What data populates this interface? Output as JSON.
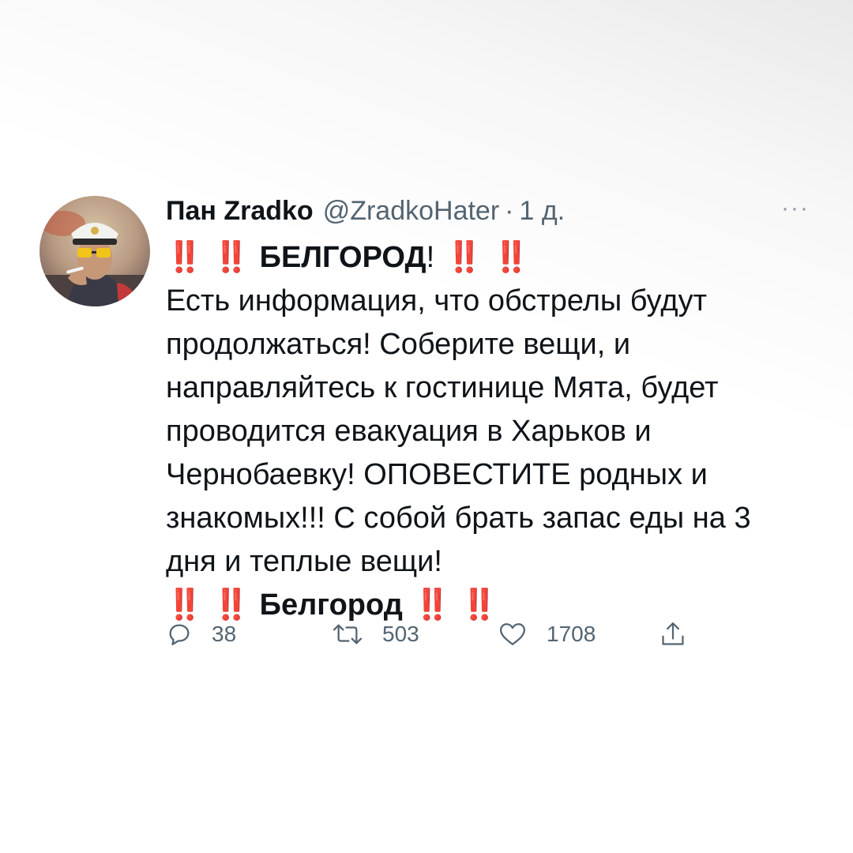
{
  "tweet": {
    "display_name": "Пан Zradko",
    "handle": "@ZradkoHater",
    "separator": "·",
    "time": "1 д.",
    "more": "···",
    "headline": {
      "marks_before": [
        "‼️",
        "‼️"
      ],
      "text": "БЕЛГОРОД",
      "bang": "!",
      "marks_after": [
        "‼️",
        "‼️"
      ]
    },
    "body": "Есть информация, что обстрелы будут продолжаться! Соберите вещи, и направляйтесь к гостинице Мята, будет проводится евакуация в Харьков и Чернобаевку! ОПОВЕСТИТЕ родных и знакомых!!! С собой брать запас еды на 3 дня и теплые вещи!",
    "footer": {
      "marks_before": [
        "‼️",
        "‼️"
      ],
      "text": "Белгород",
      "marks_after": [
        "‼️",
        "‼️"
      ]
    }
  },
  "actions": {
    "reply": {
      "icon": "reply-icon",
      "count": "38"
    },
    "retweet": {
      "icon": "retweet-icon",
      "count": "503"
    },
    "like": {
      "icon": "heart-icon",
      "count": "1708"
    },
    "share": {
      "icon": "share-icon"
    }
  },
  "colors": {
    "text": "#0f1419",
    "muted": "#536471",
    "alert_red": "#e0241b"
  }
}
